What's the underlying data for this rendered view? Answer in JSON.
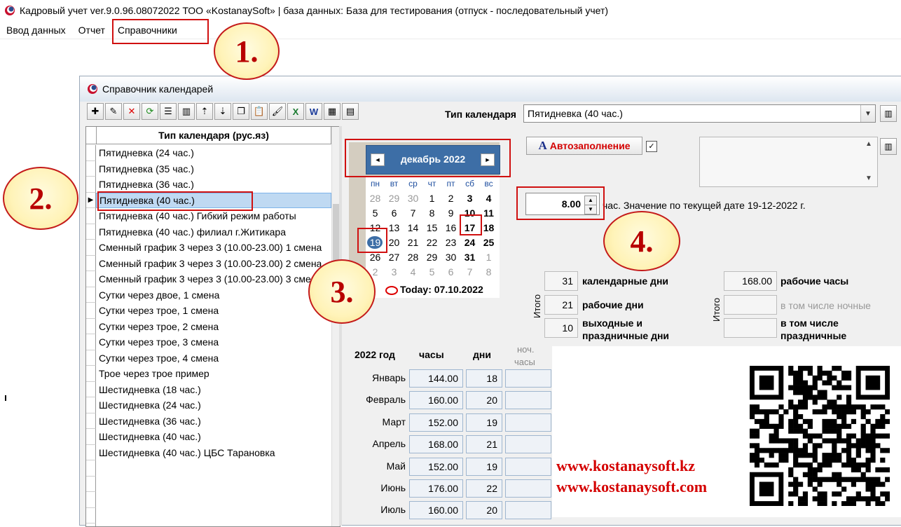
{
  "app": {
    "title": "Кадровый учет ver.9.0.96.08072022 ТОО «KostanaySoft» | база данных: База для тестирования (отпуск - последовательный учет)",
    "menu": [
      "Ввод данных",
      "Отчет",
      "Справочники"
    ]
  },
  "window": {
    "title": "Справочник календарей",
    "toolbar_icons": [
      "add-icon",
      "edit-icon",
      "delete-icon",
      "refresh-icon",
      "list-icon",
      "book-icon",
      "sort-up-icon",
      "sort-down-icon",
      "copy-icon",
      "paste-icon",
      "brush-icon",
      "excel-icon",
      "word-icon",
      "calculator-icon",
      "grid-icon"
    ],
    "calendar_type_label": "Тип календаря",
    "calendar_type_value": "Пятидневка (40 час.)"
  },
  "grid": {
    "header": "Тип календаря (рус.яз)",
    "rows": [
      "Пятидневка (24 час.)",
      "Пятидневка (35 час.)",
      "Пятидневка (36 час.)",
      "Пятидневка (40 час.)",
      "Пятидневка (40 час.) Гибкий режим работы",
      "Пятидневка (40 час.) филиал г.Житикара",
      "Сменный график 3 через 3 (10.00-23.00) 1 смена",
      "Сменный график 3 через 3 (10.00-23.00) 2 смена",
      "Сменный график 3 через 3 (10.00-23.00) 3 смена",
      "Сутки через двое, 1 смена",
      "Сутки через трое, 1 смена",
      "Сутки через трое, 2 смена",
      "Сутки через трое, 3 смена",
      "Сутки через трое, 4 смена",
      "Трое через трое пример",
      "Шестидневка (18 час.)",
      "Шестидневка (24 час.)",
      "Шестидневка (36 час.)",
      "Шестидневка (40 час.)",
      "Шестидневка (40 час.) ЦБС Тарановка"
    ],
    "selected_index": 3,
    "row_pointer": "▶"
  },
  "calendar": {
    "month_title": "декабрь 2022",
    "prev": "◄",
    "next": "►",
    "weekdays": [
      "пн",
      "вт",
      "ср",
      "чт",
      "пт",
      "сб",
      "вс"
    ],
    "weeks": [
      [
        "28",
        "29",
        "30",
        "1",
        "2",
        "3",
        "4"
      ],
      [
        "5",
        "6",
        "7",
        "8",
        "9",
        "10",
        "11"
      ],
      [
        "12",
        "13",
        "14",
        "15",
        "16",
        "17",
        "18"
      ],
      [
        "19",
        "20",
        "21",
        "22",
        "23",
        "24",
        "25"
      ],
      [
        "26",
        "27",
        "28",
        "29",
        "30",
        "31",
        "1"
      ],
      [
        "2",
        "3",
        "4",
        "5",
        "6",
        "7",
        "8"
      ]
    ],
    "today_text": "Today: 07.10.2022"
  },
  "autofill": {
    "icon": "A",
    "label": "Автозаполнение",
    "checked": "✓"
  },
  "hours": {
    "value": "8.00",
    "note": "час. Значение по текущей дате 19-12-2022 г."
  },
  "totals": {
    "vertical_label": "Итого",
    "calendar_days": "31",
    "calendar_days_label": "календарные дни",
    "work_days": "21",
    "work_days_label": "рабочие дни",
    "off_days": "10",
    "off_days_label_1": "выходные и",
    "off_days_label_2": "праздничные дни",
    "work_hours": "168.00",
    "work_hours_label": "рабочие часы",
    "night_label": "в том числе ночные",
    "holiday_label_1": "в том числе",
    "holiday_label_2": "праздничные"
  },
  "months": {
    "year_header": "2022 год",
    "hours_header": "часы",
    "days_header": "дни",
    "night_header_1": "ноч.",
    "night_header_2": "часы",
    "rows": [
      {
        "name": "Январь",
        "hours": "144.00",
        "days": "18"
      },
      {
        "name": "Февраль",
        "hours": "160.00",
        "days": "20"
      },
      {
        "name": "Март",
        "hours": "152.00",
        "days": "19"
      },
      {
        "name": "Апрель",
        "hours": "168.00",
        "days": "21"
      },
      {
        "name": "Май",
        "hours": "152.00",
        "days": "19"
      },
      {
        "name": "Июнь",
        "hours": "176.00",
        "days": "22"
      },
      {
        "name": "Июль",
        "hours": "160.00",
        "days": "20"
      }
    ]
  },
  "annotations": [
    "1.",
    "2.",
    "3.",
    "4."
  ],
  "promo": {
    "url1": "www.kostanaysoft.kz",
    "url2": "www.kostanaysoft.com"
  },
  "colors": {
    "accent_red": "#d01010",
    "calendar_header": "#3d6ea6",
    "selection": "#bfd9f2"
  }
}
